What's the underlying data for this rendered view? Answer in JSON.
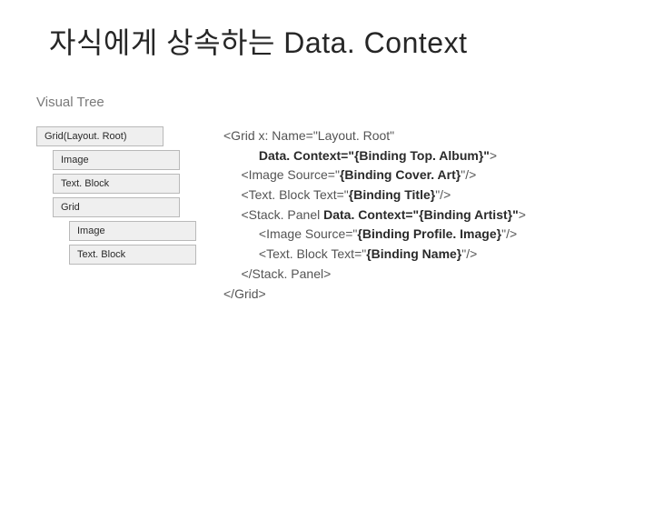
{
  "title": "자식에게 상속하는 Data. Context",
  "subtitle": "Visual Tree",
  "tree": {
    "n0": "Grid(Layout. Root)",
    "n1": "Image",
    "n2": "Text. Block",
    "n3": "Grid",
    "n4": "Image",
    "n5": "Text. Block"
  },
  "code": {
    "l1a": "<Grid x: Name=\"Layout. Root\"",
    "l2a": "          ",
    "l2b": "Data. Context=\"{Binding Top. Album}\"",
    "l2c": ">",
    "l3a": "     <Image Source=\"",
    "l3b": "{Binding Cover. Art}",
    "l3c": "\"/>",
    "l4a": "     <Text. Block Text=\"",
    "l4b": "{Binding Title}",
    "l4c": "\"/>",
    "l5a": "     <Stack. Panel ",
    "l5b": "Data. Context=\"{Binding Artist}\"",
    "l5c": ">",
    "l6a": "          <Image Source=\"",
    "l6b": "{Binding Profile. Image}",
    "l6c": "\"/>",
    "l7a": "          <Text. Block Text=\"",
    "l7b": "{Binding Name}",
    "l7c": "\"/>",
    "l8": "     </Stack. Panel>",
    "l9": "</Grid>"
  }
}
